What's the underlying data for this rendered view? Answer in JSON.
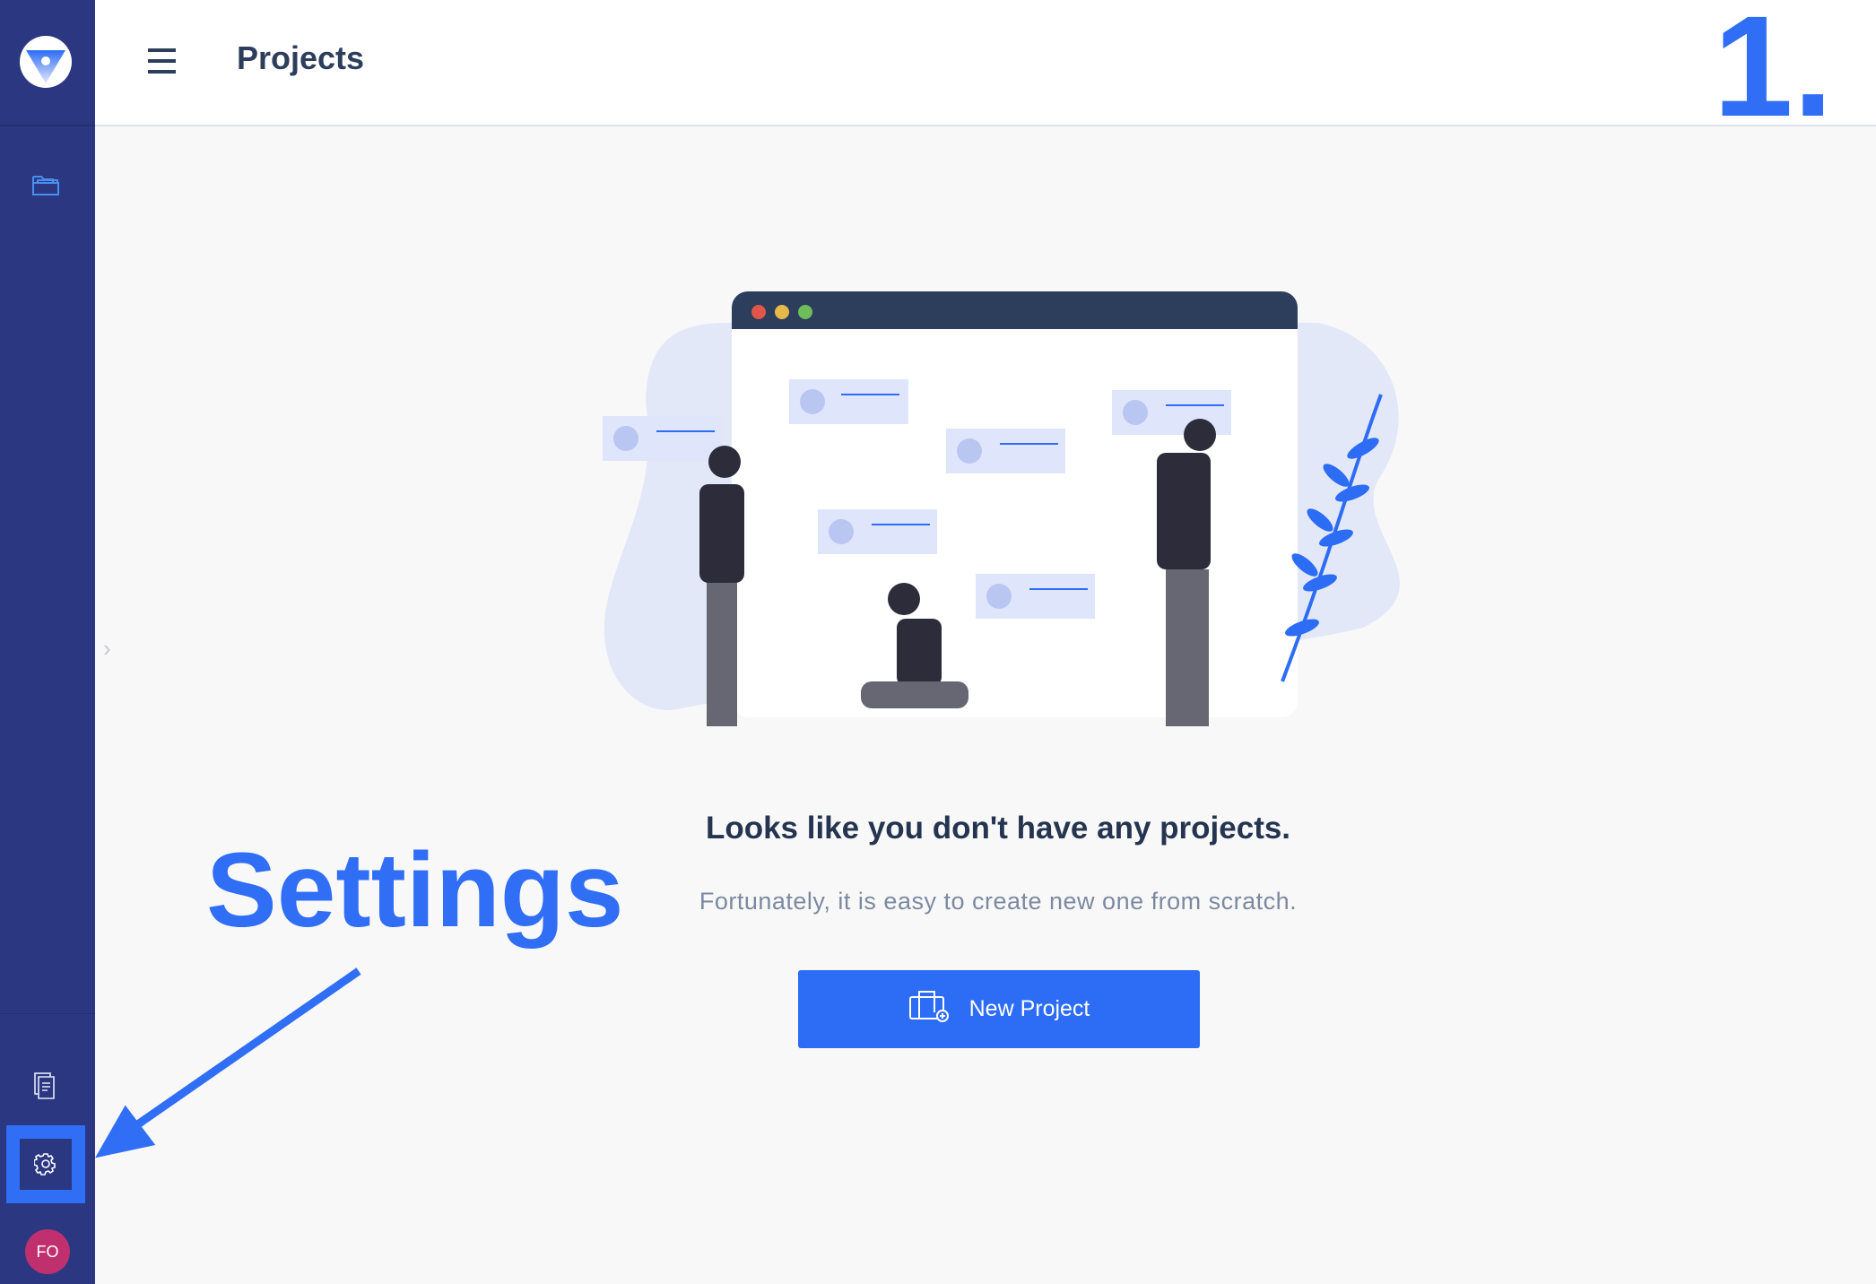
{
  "header": {
    "title": "Projects",
    "step": "1."
  },
  "sidebar": {
    "avatar_initials": "FO"
  },
  "annotation": {
    "label": "Settings"
  },
  "empty_state": {
    "heading": "Looks like you don't have any projects.",
    "subtitle": "Fortunately, it is easy to create new one from scratch.",
    "button_label": "New Project"
  },
  "colors": {
    "sidebar": "#2b3781",
    "accent": "#2d6cf5",
    "avatar": "#c0306f"
  }
}
